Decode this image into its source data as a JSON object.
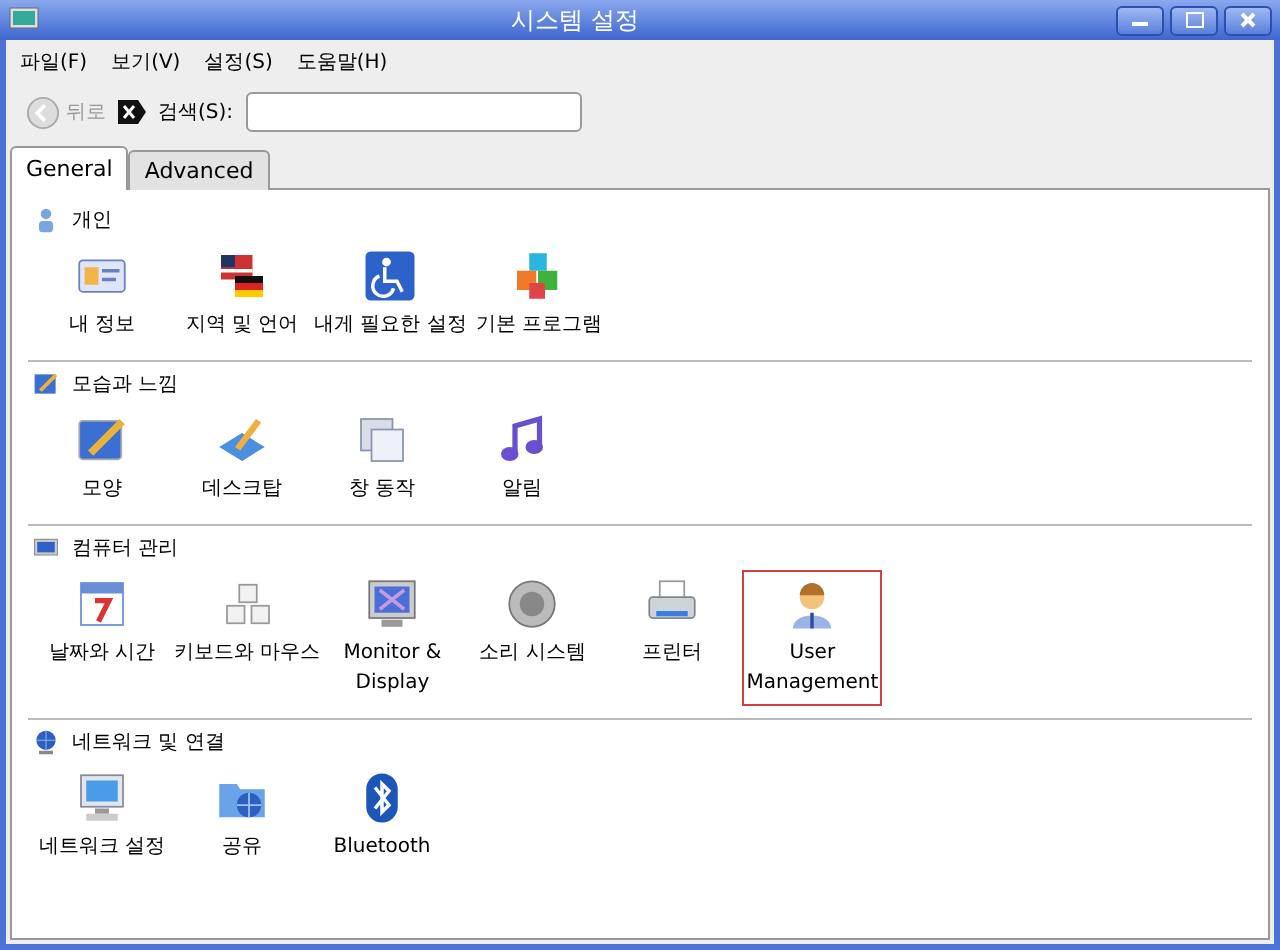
{
  "window": {
    "title": "시스템 설정"
  },
  "menu": [
    "파일(F)",
    "보기(V)",
    "설정(S)",
    "도움말(H)"
  ],
  "toolbar": {
    "back": {
      "label": "뒤로",
      "disabled": true
    },
    "search_label": "검색(S):"
  },
  "tabs": [
    {
      "label": "General",
      "selected": true
    },
    {
      "label": "Advanced",
      "selected": false
    }
  ],
  "sections": [
    {
      "title": "개인",
      "items": [
        {
          "label": "내 정보",
          "selected": false
        },
        {
          "label": "지역 및 언어",
          "selected": false
        },
        {
          "label": "내게 필요한 설정",
          "selected": false
        },
        {
          "label": "기본 프로그램",
          "selected": false
        }
      ]
    },
    {
      "title": "모습과 느낌",
      "items": [
        {
          "label": "모양",
          "selected": false
        },
        {
          "label": "데스크탑",
          "selected": false
        },
        {
          "label": "창 동작",
          "selected": false
        },
        {
          "label": "알림",
          "selected": false
        }
      ]
    },
    {
      "title": "컴퓨터 관리",
      "items": [
        {
          "label": "날짜와 시간",
          "selected": false
        },
        {
          "label": "키보드와 마우스",
          "selected": false
        },
        {
          "label": "Monitor & Display",
          "selected": false
        },
        {
          "label": "소리 시스템",
          "selected": false
        },
        {
          "label": "프린터",
          "selected": false
        },
        {
          "label": "User Management",
          "selected": true
        }
      ]
    },
    {
      "title": "네트워크 및 연결",
      "items": [
        {
          "label": "네트워크 설정",
          "selected": false
        },
        {
          "label": "공유",
          "selected": false
        },
        {
          "label": "Bluetooth",
          "selected": false
        }
      ]
    }
  ]
}
